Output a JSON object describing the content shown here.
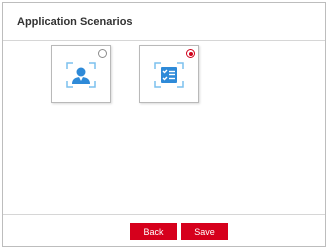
{
  "dialog": {
    "title": "Application Scenarios"
  },
  "scenarios": [
    {
      "icon": "person-capture-icon",
      "selected": false
    },
    {
      "icon": "checklist-icon",
      "selected": true
    }
  ],
  "colors": {
    "accent": "#d6001c",
    "icon_blue": "#2e8ad8",
    "icon_light_blue": "#7cc0ee"
  },
  "footer": {
    "back_label": "Back",
    "save_label": "Save"
  }
}
